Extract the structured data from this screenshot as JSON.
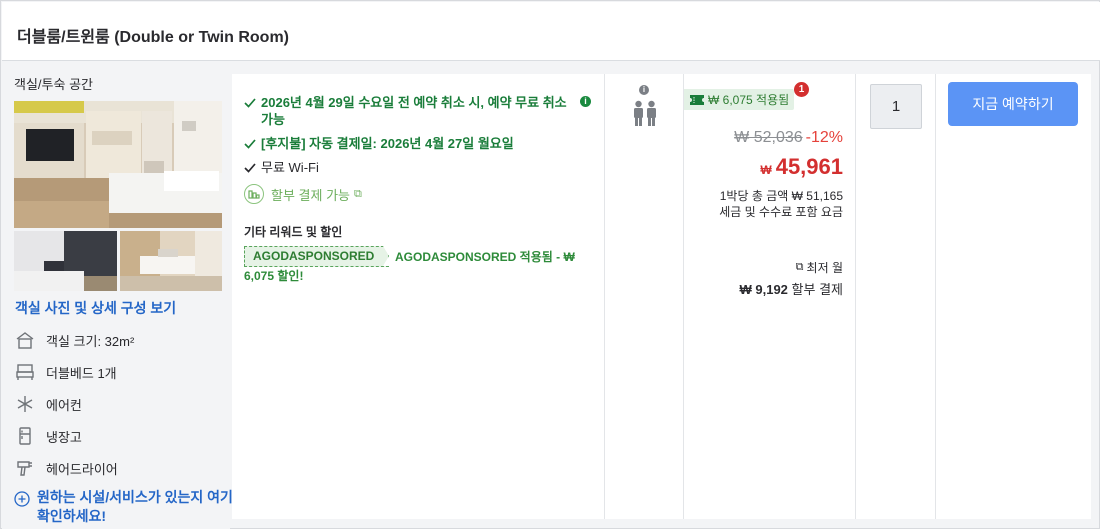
{
  "room": {
    "title": "더블룸/트윈룸 (Double or Twin Room)"
  },
  "left": {
    "photo_label": "객실/투숙 공간",
    "photo_link": "객실 사진 및 상세 구성 보기",
    "amenities": [
      {
        "icon": "room-size-icon",
        "label": "객실 크기: 32m²"
      },
      {
        "icon": "bed-icon",
        "label": "더블베드 1개"
      },
      {
        "icon": "snowflake-icon",
        "label": "에어컨"
      },
      {
        "icon": "fridge-icon",
        "label": "냉장고"
      },
      {
        "icon": "hairdryer-icon",
        "label": "헤어드라이어"
      }
    ],
    "facility_link": "원하는 시설/서비스가 있는지 여기서 확인하세요!"
  },
  "benefits": {
    "items": [
      "2026년 4월 29일 수요일 전 예약 취소 시, 예약 무료 취소 가능",
      "[후지불] 자동 결제일: 2026년 4월 27일 월요일",
      "무료 Wi-Fi"
    ],
    "installment": "할부 결제 가능",
    "other_title": "기타 리워드 및 할인",
    "promo_code": "AGODASPONSORED",
    "promo_text": "AGODASPONSORED 적용됨 - ₩ 6,075 할인!"
  },
  "occupancy": {
    "icon": "two-guests-icon",
    "guests": 2
  },
  "price": {
    "coupon_label": "₩ 6,075 적용됨",
    "coupon_count": "1",
    "original": "₩ 52,036",
    "discount": "-12%",
    "currency": "₩",
    "final": "45,961",
    "per_night": "1박당 총 금액 ₩ 51,165",
    "tax_note": "세금 및 수수료 포함 요금",
    "min_month": "최저 월",
    "monthly_amount": "₩ 9,192",
    "monthly_suffix": "할부 결제"
  },
  "quantity": {
    "value": "1"
  },
  "book": {
    "label": "지금 예약하기"
  },
  "colors": {
    "accent_blue": "#5b94f5",
    "link_blue": "#2466c7",
    "green": "#1a7d3a",
    "price_red": "#d32f2f"
  }
}
